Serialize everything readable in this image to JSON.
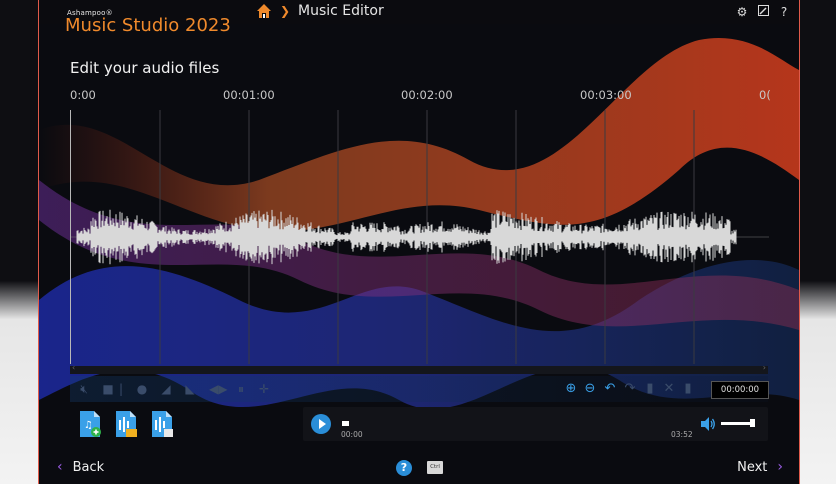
{
  "app": {
    "brand_small": "Ashampoo®",
    "brand_main": "Music Studio 2023",
    "accent_color": "#f08a2c",
    "brand_color": "#f08a2c"
  },
  "header": {
    "home_icon": "home-icon",
    "breadcrumb_separator": "❯",
    "breadcrumb": "Music Editor",
    "top_icons": [
      "gear-icon",
      "edit-icon",
      "help-icon"
    ]
  },
  "main": {
    "heading": "Edit your audio files",
    "timeline_ticks": [
      "0:00",
      "00:01:00",
      "00:02:00",
      "00:03:00",
      "0("
    ],
    "current_time": "00:00:00",
    "file_actions": [
      "add-audio-file-icon",
      "open-audio-folder-icon",
      "export-audio-icon"
    ],
    "edit_tools_disabled": [
      "mute-icon",
      "delete-icon",
      "normalize-icon",
      "fade-in-icon",
      "fade-out-icon",
      "reverse-icon",
      "split-icon",
      "cut-marker-icon"
    ],
    "edit_tools_enabled": [
      "zoom-in-icon",
      "zoom-out-icon",
      "undo-icon"
    ],
    "edit_tools_disabled_right": [
      "redo-icon",
      "copy-icon",
      "cut-icon",
      "paste-icon"
    ]
  },
  "player": {
    "time_start": "00:00",
    "time_end": "03:52",
    "volume": 1.0,
    "position": 0.0
  },
  "footer": {
    "back_label": "Back",
    "next_label": "Next",
    "help_label": "?",
    "ctrl_label": "Ctrl"
  }
}
